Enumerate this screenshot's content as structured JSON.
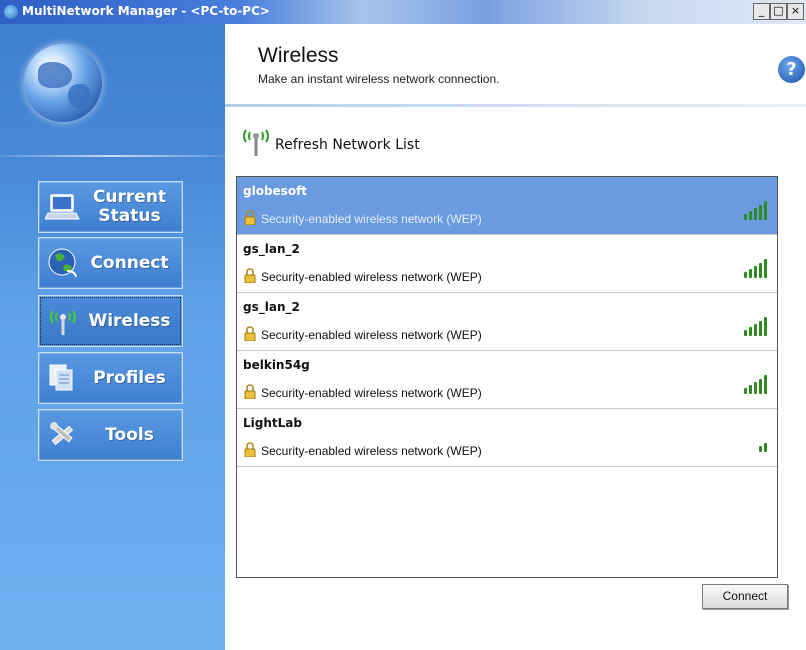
{
  "window": {
    "title": "MultiNetwork Manager - <PC-to-PC>",
    "controls": {
      "minimize": "_",
      "maximize": "□",
      "close": "×"
    }
  },
  "sidebar": {
    "items": [
      {
        "label": "Current Status",
        "icon": "laptop-icon"
      },
      {
        "label": "Connect",
        "icon": "globe-connect-icon"
      },
      {
        "label": "Wireless",
        "icon": "antenna-icon",
        "active": true
      },
      {
        "label": "Profiles",
        "icon": "documents-icon"
      },
      {
        "label": "Tools",
        "icon": "tools-icon"
      }
    ]
  },
  "header": {
    "title": "Wireless",
    "subtitle": "Make an instant wireless network connection.",
    "help": "?"
  },
  "refresh": {
    "label": "Refresh Network List"
  },
  "networks": [
    {
      "name": "globesoft",
      "security": "Security-enabled wireless network (WEP)",
      "signal": 5,
      "selected": true
    },
    {
      "name": "gs_lan_2",
      "security": "Security-enabled wireless network (WEP)",
      "signal": 5,
      "selected": false
    },
    {
      "name": "gs_lan_2",
      "security": "Security-enabled wireless network (WEP)",
      "signal": 5,
      "selected": false
    },
    {
      "name": "belkin54g",
      "security": "Security-enabled wireless network (WEP)",
      "signal": 5,
      "selected": false
    },
    {
      "name": "LightLab",
      "security": "Security-enabled wireless network (WEP)",
      "signal": 2,
      "selected": false
    }
  ],
  "actions": {
    "connect_label": "Connect"
  },
  "colors": {
    "sidebar": "#4a8ad8",
    "selected_row": "#6a9be0",
    "signal": "#2e8b1e"
  }
}
